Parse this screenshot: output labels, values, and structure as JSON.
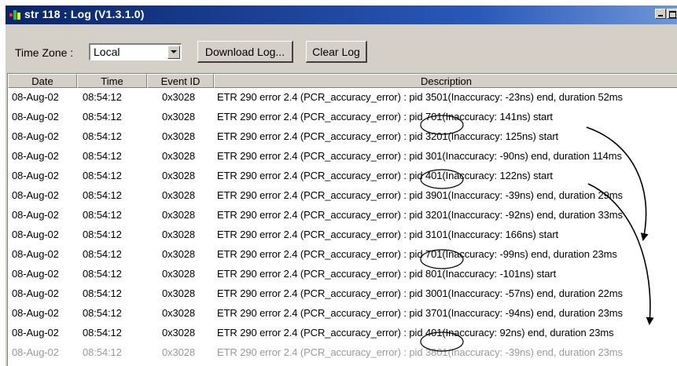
{
  "window": {
    "title": "str 118 : Log (V1.3.1.0)"
  },
  "toolbar": {
    "time_zone_label": "Time Zone :",
    "time_zone_value": "Local",
    "download_label": "Download Log...",
    "clear_label": "Clear Log"
  },
  "table": {
    "columns": [
      "Date",
      "Time",
      "Event ID",
      "Description"
    ],
    "rows": [
      [
        "08-Aug-02",
        "08:54:12",
        "0x3028",
        "ETR 290 error 2.4 (PCR_accuracy_error) : pid 3501(Inaccuracy: -23ns) end, duration 52ms"
      ],
      [
        "08-Aug-02",
        "08:54:12",
        "0x3028",
        "ETR 290 error 2.4 (PCR_accuracy_error) : pid 701(Inaccuracy: 141ns) start"
      ],
      [
        "08-Aug-02",
        "08:54:12",
        "0x3028",
        "ETR 290 error 2.4 (PCR_accuracy_error) : pid 3201(Inaccuracy: 125ns) start"
      ],
      [
        "08-Aug-02",
        "08:54:12",
        "0x3028",
        "ETR 290 error 2.4 (PCR_accuracy_error) : pid 301(Inaccuracy: -90ns) end, duration 114ms"
      ],
      [
        "08-Aug-02",
        "08:54:12",
        "0x3028",
        "ETR 290 error 2.4 (PCR_accuracy_error) : pid 401(Inaccuracy: 122ns) start"
      ],
      [
        "08-Aug-02",
        "08:54:12",
        "0x3028",
        "ETR 290 error 2.4 (PCR_accuracy_error) : pid 3901(Inaccuracy: -39ns) end, duration 29ms"
      ],
      [
        "08-Aug-02",
        "08:54:12",
        "0x3028",
        "ETR 290 error 2.4 (PCR_accuracy_error) : pid 3201(Inaccuracy: -92ns) end, duration 33ms"
      ],
      [
        "08-Aug-02",
        "08:54:12",
        "0x3028",
        "ETR 290 error 2.4 (PCR_accuracy_error) : pid 3101(Inaccuracy: 166ns) start"
      ],
      [
        "08-Aug-02",
        "08:54:12",
        "0x3028",
        "ETR 290 error 2.4 (PCR_accuracy_error) : pid 701(Inaccuracy: -99ns) end, duration 23ms"
      ],
      [
        "08-Aug-02",
        "08:54:12",
        "0x3028",
        "ETR 290 error 2.4 (PCR_accuracy_error) : pid 801(Inaccuracy: -101ns) start"
      ],
      [
        "08-Aug-02",
        "08:54:12",
        "0x3028",
        "ETR 290 error 2.4 (PCR_accuracy_error) : pid 3001(Inaccuracy: -57ns) end, duration 22ms"
      ],
      [
        "08-Aug-02",
        "08:54:12",
        "0x3028",
        "ETR 290 error 2.4 (PCR_accuracy_error) : pid 3701(Inaccuracy: -94ns) end, duration 23ms"
      ],
      [
        "08-Aug-02",
        "08:54:12",
        "0x3028",
        "ETR 290 error 2.4 (PCR_accuracy_error) : pid 401(Inaccuracy: 92ns) end, duration 23ms"
      ],
      [
        "08-Aug-02",
        "08:54:12",
        "0x3028",
        "ETR 290 error 2.4 (PCR_accuracy_error) : pid 3801(Inaccuracy: -39ns) end, duration 23ms"
      ]
    ]
  },
  "colors": {
    "title_bar": "#0a246a",
    "window_face": "#d4d0c8",
    "annotation": "#000000"
  },
  "icons": [
    "app-icon",
    "minimize-icon",
    "maximize-icon",
    "dropdown-arrow-icon"
  ]
}
